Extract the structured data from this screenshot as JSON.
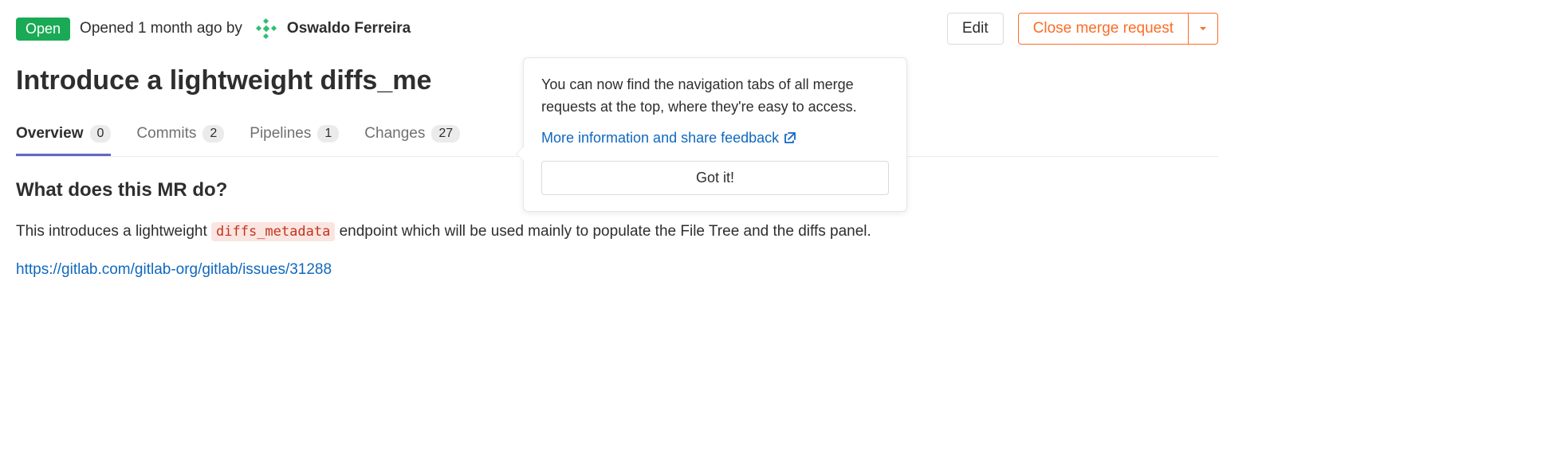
{
  "header": {
    "status": "Open",
    "opened_text": "Opened 1 month ago by",
    "author": "Oswaldo Ferreira",
    "edit_label": "Edit",
    "close_label": "Close merge request"
  },
  "title": "Introduce a lightweight diffs_me",
  "tabs": [
    {
      "label": "Overview",
      "count": "0",
      "active": true
    },
    {
      "label": "Commits",
      "count": "2",
      "active": false
    },
    {
      "label": "Pipelines",
      "count": "1",
      "active": false
    },
    {
      "label": "Changes",
      "count": "27",
      "active": false
    }
  ],
  "popover": {
    "text": "You can now find the navigation tabs of all merge requests at the top, where they're easy to access.",
    "link_label": "More information and share feedback",
    "gotit_label": "Got it!"
  },
  "content": {
    "heading": "What does this MR do?",
    "desc_prefix": "This introduces a lightweight ",
    "code": "diffs_metadata",
    "desc_suffix": " endpoint which will be used mainly to populate the File Tree and the diffs panel.",
    "issue_link": "https://gitlab.com/gitlab-org/gitlab/issues/31288"
  }
}
